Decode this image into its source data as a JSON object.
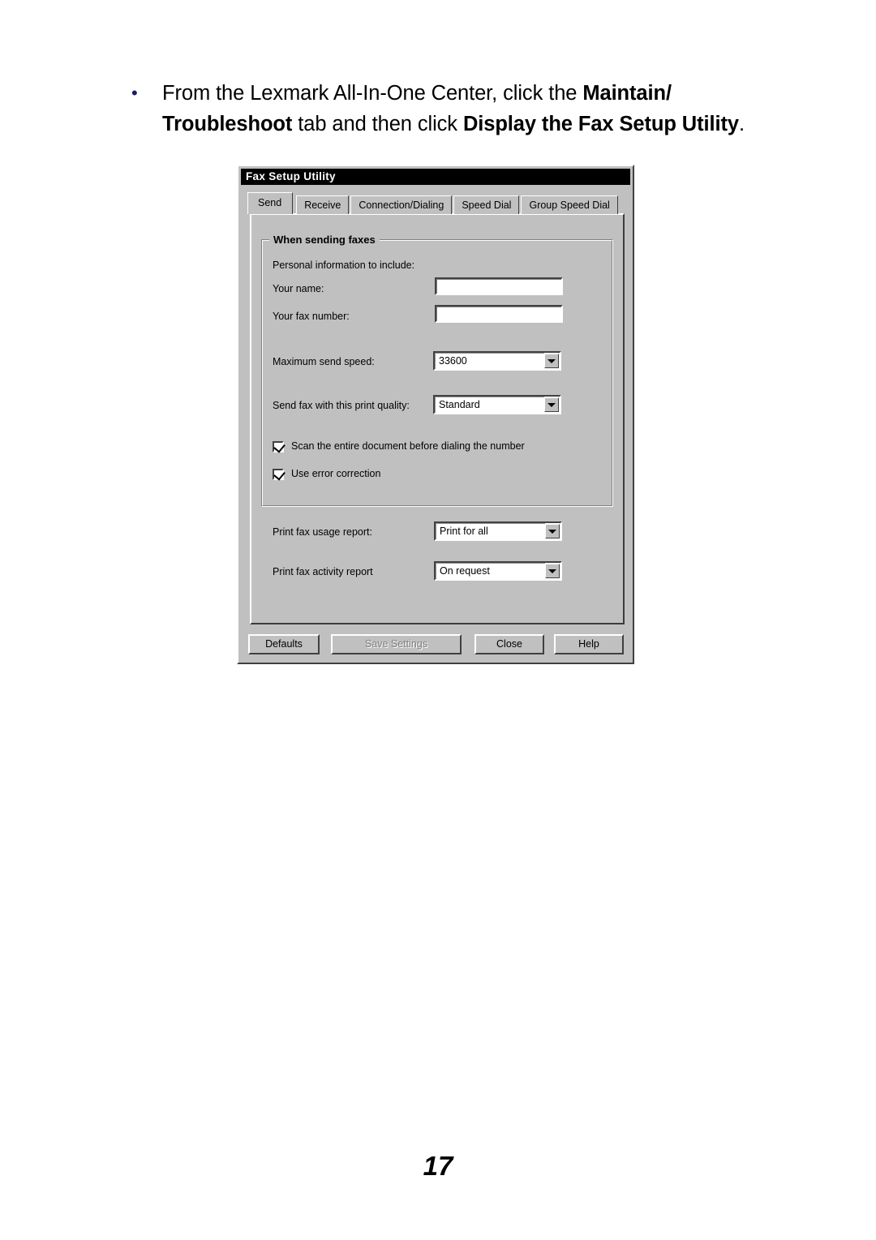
{
  "page": {
    "number": "17"
  },
  "instruction": {
    "bullet": "•",
    "line1_part1": "From the Lexmark All-In-One Center, click the ",
    "line1_bold": "Maintain/",
    "line2_bold1": "Troubleshoot",
    "line2_part1": " tab and then click ",
    "line2_bold2": "Display the Fax Setup Utility",
    "line2_end": "."
  },
  "dialog": {
    "title": "Fax Setup Utility",
    "tabs": [
      {
        "label": "Send",
        "active": true
      },
      {
        "label": "Receive",
        "active": false
      },
      {
        "label": "Connection/Dialing",
        "active": false
      },
      {
        "label": "Speed Dial",
        "active": false
      },
      {
        "label": "Group Speed Dial",
        "active": false
      }
    ],
    "groupbox": {
      "legend": "When sending faxes",
      "personal_info_label": "Personal information to include:",
      "fields": [
        {
          "label": "Your name:",
          "value": ""
        },
        {
          "label": "Your fax number:",
          "value": ""
        }
      ],
      "combos": [
        {
          "label": "Maximum send speed:",
          "value": "33600"
        },
        {
          "label": "Send fax with this print quality:",
          "value": "Standard"
        }
      ],
      "checkboxes": [
        {
          "label": "Scan the entire document before dialing the number",
          "checked": true
        },
        {
          "label": "Use error correction",
          "checked": true
        }
      ]
    },
    "reports": [
      {
        "label": "Print fax usage report:",
        "value": "Print for all"
      },
      {
        "label": "Print fax activity report",
        "value": "On request"
      }
    ],
    "buttons": [
      {
        "label": "Defaults",
        "disabled": false
      },
      {
        "label": "Save Settings",
        "disabled": true
      },
      {
        "label": "Close",
        "disabled": false
      },
      {
        "label": "Help",
        "disabled": false
      }
    ]
  },
  "colors": {
    "dialog_face": "#c0c0c0",
    "titlebar_bg": "#000000",
    "titlebar_fg": "#ffffff",
    "field_bg": "#ffffff",
    "disabled_text": "#808080",
    "bullet": "#1a1a6e"
  }
}
